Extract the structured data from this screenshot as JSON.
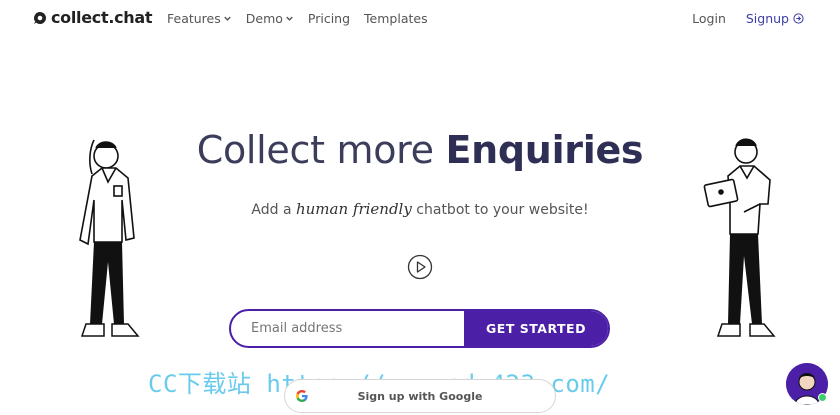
{
  "brand": {
    "name": "collect.chat"
  },
  "nav": {
    "items": [
      {
        "label": "Features",
        "has_dropdown": true
      },
      {
        "label": "Demo",
        "has_dropdown": true
      },
      {
        "label": "Pricing",
        "has_dropdown": false
      },
      {
        "label": "Templates",
        "has_dropdown": false
      }
    ],
    "login": "Login",
    "signup": "Signup"
  },
  "hero": {
    "headline_prefix": "Collect more ",
    "headline_strong": "Enquiries",
    "sub_prefix": "Add a ",
    "sub_script": "human friendly",
    "sub_suffix": " chatbot to your website!"
  },
  "cta": {
    "email_placeholder": "Email address",
    "button": "GET STARTED"
  },
  "google": {
    "label": "Sign up with Google"
  },
  "watermark": "CC下载站 https://www.cdz423.com/",
  "colors": {
    "accent": "#4b1fa6",
    "headline": "#3b3d5a",
    "watermark": "#4fc3e8",
    "online": "#3ecf6c"
  },
  "icons": [
    "logo-icon",
    "chevron-down-icon",
    "signup-arrow-icon",
    "play-icon",
    "google-icon",
    "chat-avatar-icon"
  ]
}
